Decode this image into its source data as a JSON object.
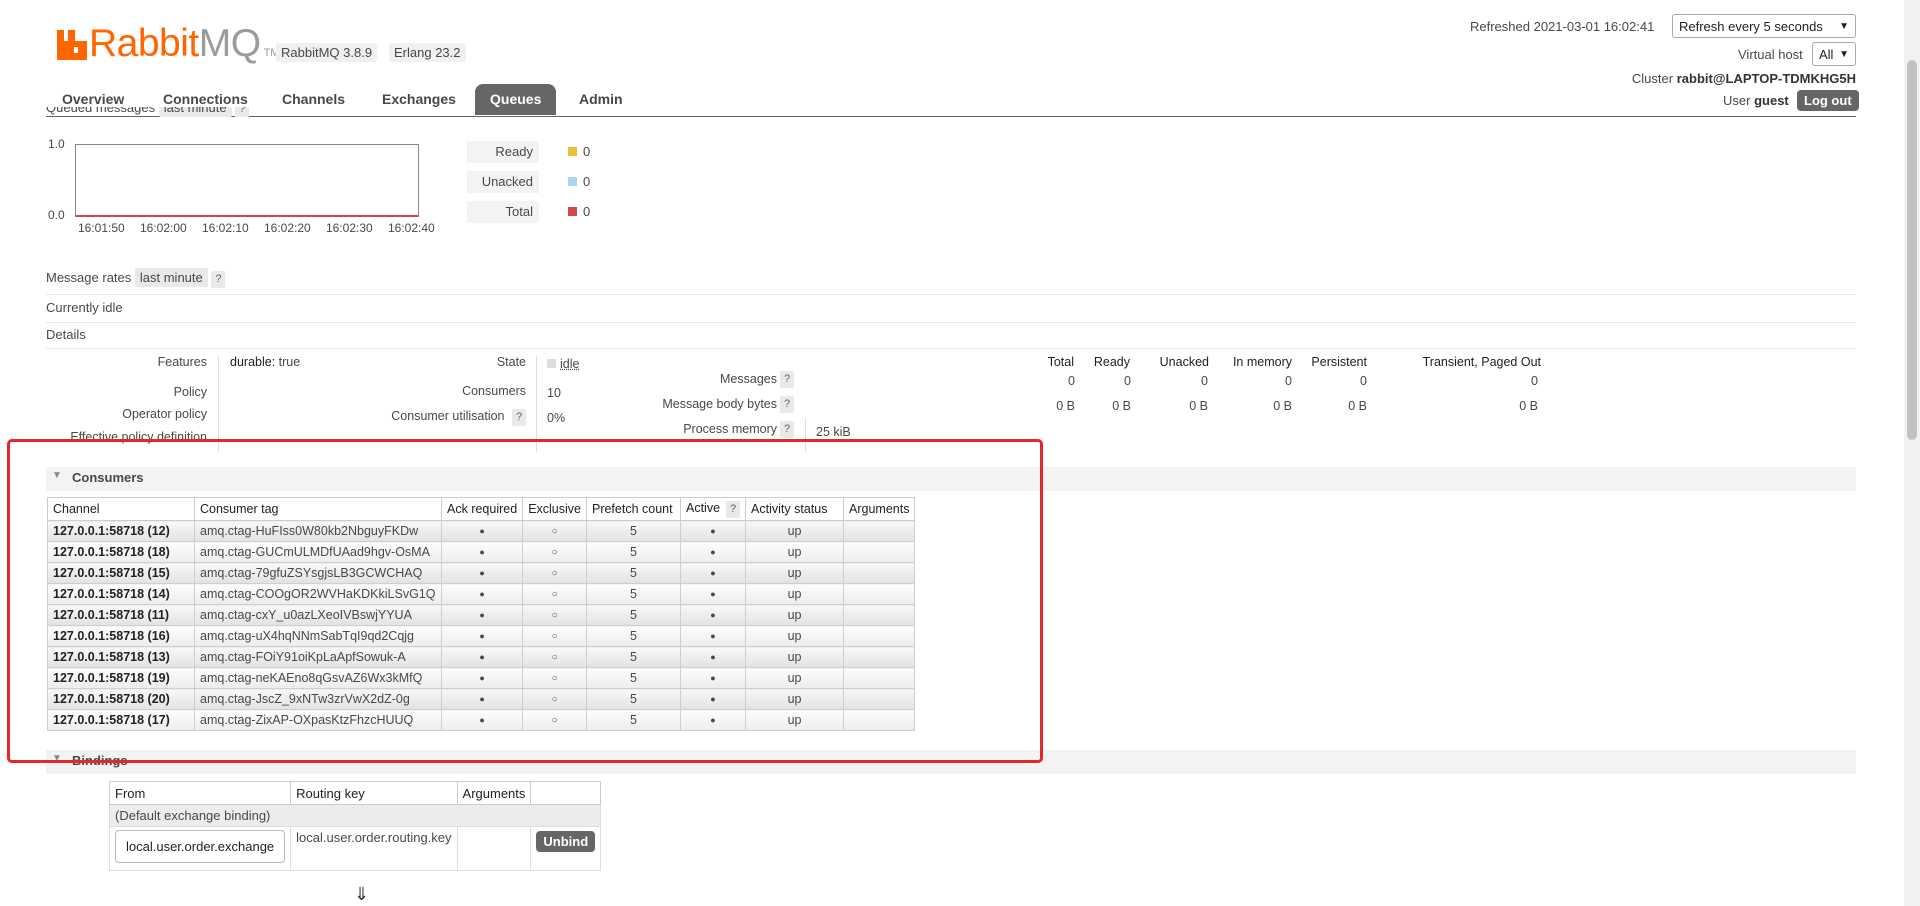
{
  "app": {
    "logo_main": "Rabbit",
    "logo_mq": "MQ",
    "logo_tm": "TM",
    "version": "RabbitMQ 3.8.9",
    "erlang": "Erlang 23.2"
  },
  "tabs": [
    "Overview",
    "Connections",
    "Channels",
    "Exchanges",
    "Queues",
    "Admin"
  ],
  "active_tab": "Queues",
  "header": {
    "refreshed": "Refreshed 2021-03-01 16:02:41",
    "refresh_option": "Refresh every 5 seconds",
    "vhost_label": "Virtual host",
    "vhost_value": "All",
    "cluster_label": "Cluster",
    "cluster_value": "rabbit@LAPTOP-TDMKHG5H",
    "user_label": "User",
    "user_value": "guest",
    "logout": "Log out"
  },
  "queued_messages": {
    "title": "Queued messages",
    "range": "last minute",
    "help": "?",
    "y_top": "1.0",
    "y_bottom": "0.0",
    "x_ticks": [
      "16:01:50",
      "16:02:00",
      "16:02:10",
      "16:02:20",
      "16:02:30",
      "16:02:40"
    ],
    "legend": [
      {
        "label": "Ready",
        "value": "0",
        "color": "#e8c137"
      },
      {
        "label": "Unacked",
        "value": "0",
        "color": "#aad4f0"
      },
      {
        "label": "Total",
        "value": "0",
        "color": "#d44848"
      }
    ]
  },
  "message_rates": {
    "title": "Message rates",
    "range": "last minute",
    "help": "?"
  },
  "status": "Currently idle",
  "details": {
    "title": "Details",
    "features_label": "Features",
    "features_key": "durable:",
    "features_val": "true",
    "policy_label": "Policy",
    "operator_policy_label": "Operator policy",
    "effective_policy_label": "Effective policy definition",
    "state_label": "State",
    "state_val": "idle",
    "consumers_label": "Consumers",
    "consumers_val": "10",
    "utilisation_label": "Consumer utilisation",
    "utilisation_val": "0%",
    "help": "?",
    "stats_headers": [
      "Total",
      "Ready",
      "Unacked",
      "In memory",
      "Persistent",
      "Transient, Paged Out"
    ],
    "messages_label": "Messages",
    "messages_vals": [
      "0",
      "0",
      "0",
      "0",
      "0",
      "0"
    ],
    "body_label": "Message body bytes",
    "body_vals": [
      "0 B",
      "0 B",
      "0 B",
      "0 B",
      "0 B",
      "0 B"
    ],
    "process_label": "Process memory",
    "process_val": "25 kiB"
  },
  "consumers": {
    "title": "Consumers",
    "headers": [
      "Channel",
      "Consumer tag",
      "Ack required",
      "Exclusive",
      "Prefetch count",
      "Active",
      "Activity status",
      "Arguments"
    ],
    "active_help": "?",
    "rows": [
      {
        "channel": "127.0.0.1:58718 (12)",
        "tag": "amq.ctag-HuFIss0W80kb2NbguyFKDw",
        "ack": "●",
        "excl": "○",
        "prefetch": "5",
        "active": "●",
        "status": "up"
      },
      {
        "channel": "127.0.0.1:58718 (18)",
        "tag": "amq.ctag-GUCmULMDfUAad9hgv-OsMA",
        "ack": "●",
        "excl": "○",
        "prefetch": "5",
        "active": "●",
        "status": "up"
      },
      {
        "channel": "127.0.0.1:58718 (15)",
        "tag": "amq.ctag-79gfuZSYsgjsLB3GCWCHAQ",
        "ack": "●",
        "excl": "○",
        "prefetch": "5",
        "active": "●",
        "status": "up"
      },
      {
        "channel": "127.0.0.1:58718 (14)",
        "tag": "amq.ctag-COOgOR2WVHaKDKkiLSvG1Q",
        "ack": "●",
        "excl": "○",
        "prefetch": "5",
        "active": "●",
        "status": "up"
      },
      {
        "channel": "127.0.0.1:58718 (11)",
        "tag": "amq.ctag-cxY_u0azLXeoIVBswjYYUA",
        "ack": "●",
        "excl": "○",
        "prefetch": "5",
        "active": "●",
        "status": "up"
      },
      {
        "channel": "127.0.0.1:58718 (16)",
        "tag": "amq.ctag-uX4hqNNmSabTqI9qd2Cqjg",
        "ack": "●",
        "excl": "○",
        "prefetch": "5",
        "active": "●",
        "status": "up"
      },
      {
        "channel": "127.0.0.1:58718 (13)",
        "tag": "amq.ctag-FOiY91oiKpLaApfSowuk-A",
        "ack": "●",
        "excl": "○",
        "prefetch": "5",
        "active": "●",
        "status": "up"
      },
      {
        "channel": "127.0.0.1:58718 (19)",
        "tag": "amq.ctag-neKAEno8qGsvAZ6Wx3kMfQ",
        "ack": "●",
        "excl": "○",
        "prefetch": "5",
        "active": "●",
        "status": "up"
      },
      {
        "channel": "127.0.0.1:58718 (20)",
        "tag": "amq.ctag-JscZ_9xNTw3zrVwX2dZ-0g",
        "ack": "●",
        "excl": "○",
        "prefetch": "5",
        "active": "●",
        "status": "up"
      },
      {
        "channel": "127.0.0.1:58718 (17)",
        "tag": "amq.ctag-ZixAP-OXpasKtzFhzcHUUQ",
        "ack": "●",
        "excl": "○",
        "prefetch": "5",
        "active": "●",
        "status": "up"
      }
    ]
  },
  "bindings": {
    "title": "Bindings",
    "headers": [
      "From",
      "Routing key",
      "Arguments",
      ""
    ],
    "default_row": "(Default exchange binding)",
    "from": "local.user.order.exchange",
    "routing_key": "local.user.order.routing.key",
    "unbind": "Unbind",
    "arrow": "⇓"
  }
}
